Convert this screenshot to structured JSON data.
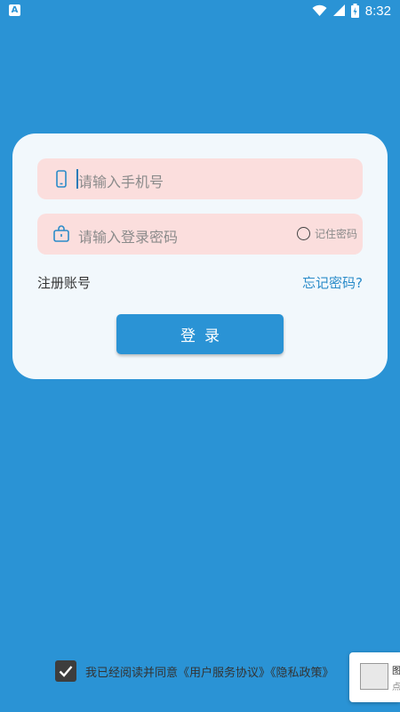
{
  "status_bar": {
    "app_indicator": "A",
    "time": "8:32",
    "icons": [
      "wifi-icon",
      "signal-icon",
      "battery-icon"
    ]
  },
  "login_card": {
    "phone_placeholder": "请输入手机号",
    "password_placeholder": "请输入登录密码",
    "remember_label": "记住密码",
    "register_link": "注册账号",
    "forgot_link": "忘记密码?",
    "login_button": "登录"
  },
  "agreement": {
    "prefix": "我已经阅读并同意",
    "service_link": "《用户服务协议》",
    "privacy_link": "《隐私政策》",
    "checked": true
  },
  "popup": {
    "line1": "图",
    "line2": "点"
  },
  "colors": {
    "background": "#2a93d5",
    "card": "#f2f8fc",
    "field": "#fbdedd",
    "accent": "#2a8bc9"
  }
}
